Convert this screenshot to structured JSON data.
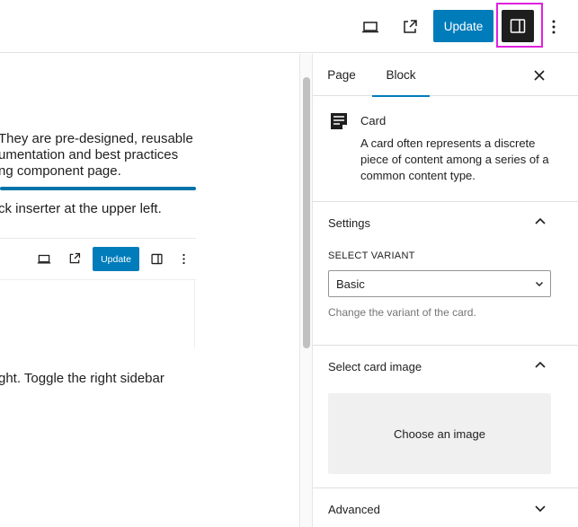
{
  "topbar": {
    "preview_icon": "laptop-icon",
    "view_icon": "external-link-icon",
    "update_label": "Update",
    "sidebar_toggle_icon": "sidebar-toggle-icon",
    "options_icon": "more-vertical-icon"
  },
  "canvas": {
    "paragraph_1": [
      "They are pre-designed, reusable",
      "umentation and best practices",
      "ng component page."
    ],
    "paragraph_2": "ck inserter at the upper left.",
    "paragraph_3": "ght. Toggle the right sidebar",
    "mini_toolbar": {
      "update_label": "Update"
    }
  },
  "sidebar": {
    "tabs": [
      {
        "label": "Page",
        "active": false
      },
      {
        "label": "Block",
        "active": true
      }
    ],
    "close_icon": "close-icon",
    "block": {
      "icon": "card-block-icon",
      "title": "Card",
      "description": "A card often represents a discrete piece of content among a series of a common content type."
    },
    "panels": {
      "settings": {
        "title": "Settings",
        "expanded": true,
        "variant_label": "SELECT VARIANT",
        "variant_value": "Basic",
        "variant_help": "Change the variant of the card."
      },
      "image": {
        "title": "Select card image",
        "expanded": true,
        "choose_label": "Choose an image"
      },
      "advanced": {
        "title": "Advanced",
        "expanded": false
      }
    }
  },
  "colors": {
    "accent": "#007cba",
    "highlight": "#e020e0",
    "dark": "#1e1e1e"
  }
}
